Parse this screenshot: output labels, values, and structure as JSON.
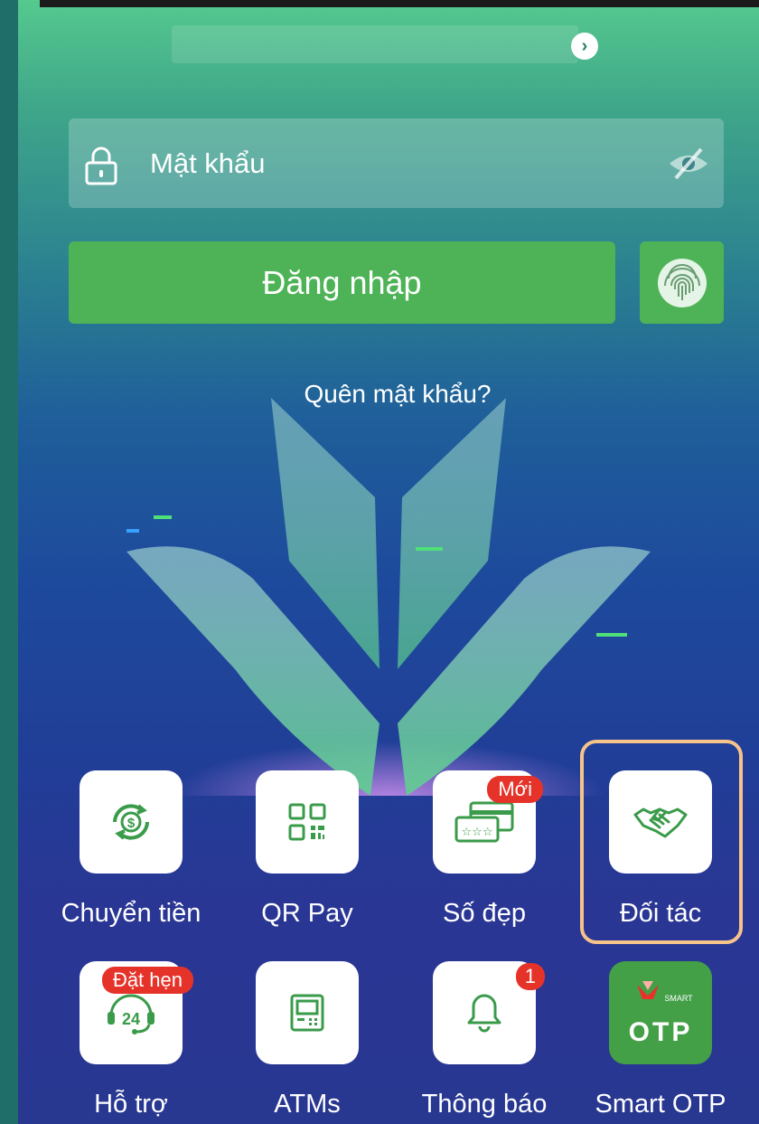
{
  "header": {
    "chevron_icon": "chevron-right-icon"
  },
  "password": {
    "placeholder": "Mật khẩu",
    "lock_icon": "lock-icon",
    "eye_icon": "eye-off-icon"
  },
  "login": {
    "label": "Đăng nhập",
    "fingerprint_icon": "fingerprint-icon"
  },
  "forgot_password": "Quên mật khẩu?",
  "shortcuts_row1": [
    {
      "label": "Chuyển tiền",
      "icon": "money-transfer-icon"
    },
    {
      "label": "QR Pay",
      "icon": "qr-code-icon"
    },
    {
      "label": "Số đẹp",
      "icon": "card-stars-icon",
      "badge": "Mới"
    },
    {
      "label": "Đối tác",
      "icon": "handshake-icon"
    }
  ],
  "shortcuts_row2": [
    {
      "label": "Hỗ trợ",
      "icon": "support-24-icon",
      "badge": "Đặt hẹn"
    },
    {
      "label": "ATMs",
      "icon": "atm-icon"
    },
    {
      "label": "Thông báo",
      "icon": "bell-icon",
      "badge": "1"
    },
    {
      "label": "Smart OTP",
      "icon": "smart-otp-icon",
      "otp_small": "SMART",
      "otp_text": "OTP"
    }
  ],
  "colors": {
    "primary_green": "#4db356",
    "badge_red": "#e5332a",
    "highlight": "#f6c38b"
  }
}
